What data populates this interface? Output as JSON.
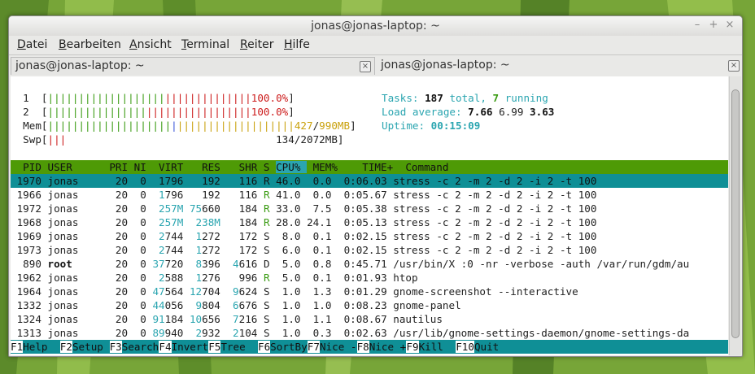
{
  "window": {
    "title": "jonas@jonas-laptop: ~",
    "buttons": {
      "minimize": "–",
      "maximize": "+",
      "close": "×"
    }
  },
  "menu": {
    "items": [
      {
        "ul": "D",
        "rest": "atei"
      },
      {
        "ul": "B",
        "rest": "earbeiten"
      },
      {
        "ul": "A",
        "rest": "nsicht"
      },
      {
        "ul": "T",
        "rest": "erminal"
      },
      {
        "ul": "R",
        "rest": "eiter"
      },
      {
        "ul": "H",
        "rest": "ilfe"
      }
    ]
  },
  "tabs": [
    {
      "label": "jonas@jonas-laptop: ~",
      "close": "⊠"
    },
    {
      "label": "jonas@jonas-laptop: ~",
      "close": "⊠"
    }
  ],
  "meters": {
    "cpu1": {
      "label": "1",
      "bar": "|||||||||||||||||||||||||||||||||",
      "percent": "100.0%"
    },
    "cpu2": {
      "label": "2",
      "bar": "|||||||||||||||||||||||||||||||||",
      "percent": "100.0%"
    },
    "mem": {
      "label": "Mem",
      "used": "427",
      "total": "990MB"
    },
    "swp": {
      "label": "Swp",
      "used": "134",
      "total": "2072MB"
    }
  },
  "summary": {
    "tasks_label": "Tasks:",
    "tasks_total": "187",
    "tasks_total_suffix": "total,",
    "tasks_running": "7",
    "tasks_running_suffix": "running",
    "load_label": "Load average:",
    "load1": "7.66",
    "load5": "6.99",
    "load15": "3.63",
    "uptime_label": "Uptime:",
    "uptime": "00:15:09"
  },
  "table": {
    "columns": [
      "PID",
      "USER",
      "PRI",
      "NI",
      "VIRT",
      "RES",
      "SHR",
      "S",
      "CPU%",
      "MEM%",
      "TIME+",
      "Command"
    ],
    "rows": [
      {
        "pid": "1970",
        "user": "jonas",
        "pri": "20",
        "ni": "0",
        "virt": "1796",
        "res": "192",
        "shr": "116",
        "s": "R",
        "cpu": "46.0",
        "mem": "0.0",
        "time": "0:06.03",
        "cmd": "stress -c 2 -m 2 -d 2 -i 2 -t 100"
      },
      {
        "pid": "1966",
        "user": "jonas",
        "pri": "20",
        "ni": "0",
        "virt": "1796",
        "res": "192",
        "shr": "116",
        "s": "R",
        "cpu": "41.0",
        "mem": "0.0",
        "time": "0:05.67",
        "cmd": "stress -c 2 -m 2 -d 2 -i 2 -t 100"
      },
      {
        "pid": "1972",
        "user": "jonas",
        "pri": "20",
        "ni": "0",
        "virt": "257M",
        "res": "75660",
        "shr": "184",
        "s": "R",
        "cpu": "33.0",
        "mem": "7.5",
        "time": "0:05.38",
        "cmd": "stress -c 2 -m 2 -d 2 -i 2 -t 100"
      },
      {
        "pid": "1968",
        "user": "jonas",
        "pri": "20",
        "ni": "0",
        "virt": "257M",
        "res": "238M",
        "shr": "184",
        "s": "R",
        "cpu": "28.0",
        "mem": "24.1",
        "time": "0:05.13",
        "cmd": "stress -c 2 -m 2 -d 2 -i 2 -t 100"
      },
      {
        "pid": "1969",
        "user": "jonas",
        "pri": "20",
        "ni": "0",
        "virt": "2744",
        "res": "1272",
        "shr": "172",
        "s": "S",
        "cpu": "8.0",
        "mem": "0.1",
        "time": "0:02.15",
        "cmd": "stress -c 2 -m 2 -d 2 -i 2 -t 100"
      },
      {
        "pid": "1973",
        "user": "jonas",
        "pri": "20",
        "ni": "0",
        "virt": "2744",
        "res": "1272",
        "shr": "172",
        "s": "S",
        "cpu": "6.0",
        "mem": "0.1",
        "time": "0:02.15",
        "cmd": "stress -c 2 -m 2 -d 2 -i 2 -t 100"
      },
      {
        "pid": "890",
        "user": "root",
        "pri": "20",
        "ni": "0",
        "virt": "37720",
        "res": "8396",
        "shr": "4616",
        "s": "D",
        "cpu": "5.0",
        "mem": "0.8",
        "time": "0:45.71",
        "cmd": "/usr/bin/X :0 -nr -verbose -auth /var/run/gdm/au"
      },
      {
        "pid": "1962",
        "user": "jonas",
        "pri": "20",
        "ni": "0",
        "virt": "2588",
        "res": "1276",
        "shr": "996",
        "s": "R",
        "cpu": "5.0",
        "mem": "0.1",
        "time": "0:01.93",
        "cmd": "htop"
      },
      {
        "pid": "1964",
        "user": "jonas",
        "pri": "20",
        "ni": "0",
        "virt": "47564",
        "res": "12704",
        "shr": "9624",
        "s": "S",
        "cpu": "1.0",
        "mem": "1.3",
        "time": "0:01.29",
        "cmd": "gnome-screenshot --interactive"
      },
      {
        "pid": "1332",
        "user": "jonas",
        "pri": "20",
        "ni": "0",
        "virt": "44056",
        "res": "9804",
        "shr": "6676",
        "s": "S",
        "cpu": "1.0",
        "mem": "1.0",
        "time": "0:08.23",
        "cmd": "gnome-panel"
      },
      {
        "pid": "1324",
        "user": "jonas",
        "pri": "20",
        "ni": "0",
        "virt": "91184",
        "res": "10656",
        "shr": "7216",
        "s": "S",
        "cpu": "1.0",
        "mem": "1.1",
        "time": "0:08.67",
        "cmd": "nautilus"
      },
      {
        "pid": "1313",
        "user": "jonas",
        "pri": "20",
        "ni": "0",
        "virt": "89940",
        "res": "2932",
        "shr": "2104",
        "s": "S",
        "cpu": "1.0",
        "mem": "0.3",
        "time": "0:02.63",
        "cmd": "/usr/lib/gnome-settings-daemon/gnome-settings-da"
      }
    ]
  },
  "function_keys": [
    {
      "key": "F1",
      "label": "Help  "
    },
    {
      "key": "F2",
      "label": "Setup "
    },
    {
      "key": "F3",
      "label": "Search"
    },
    {
      "key": "F4",
      "label": "Invert"
    },
    {
      "key": "F5",
      "label": "Tree  "
    },
    {
      "key": "F6",
      "label": "SortBy"
    },
    {
      "key": "F7",
      "label": "Nice -"
    },
    {
      "key": "F8",
      "label": "Nice +"
    },
    {
      "key": "F9",
      "label": "Kill  "
    },
    {
      "key": "F10",
      "label": "Quit"
    }
  ],
  "colors": {
    "header_bg": "#4e9a06",
    "selection_bg": "#0f8f96",
    "cyan": "#2aa5b0",
    "green": "#3a9b12",
    "red": "#cc1a1a"
  }
}
